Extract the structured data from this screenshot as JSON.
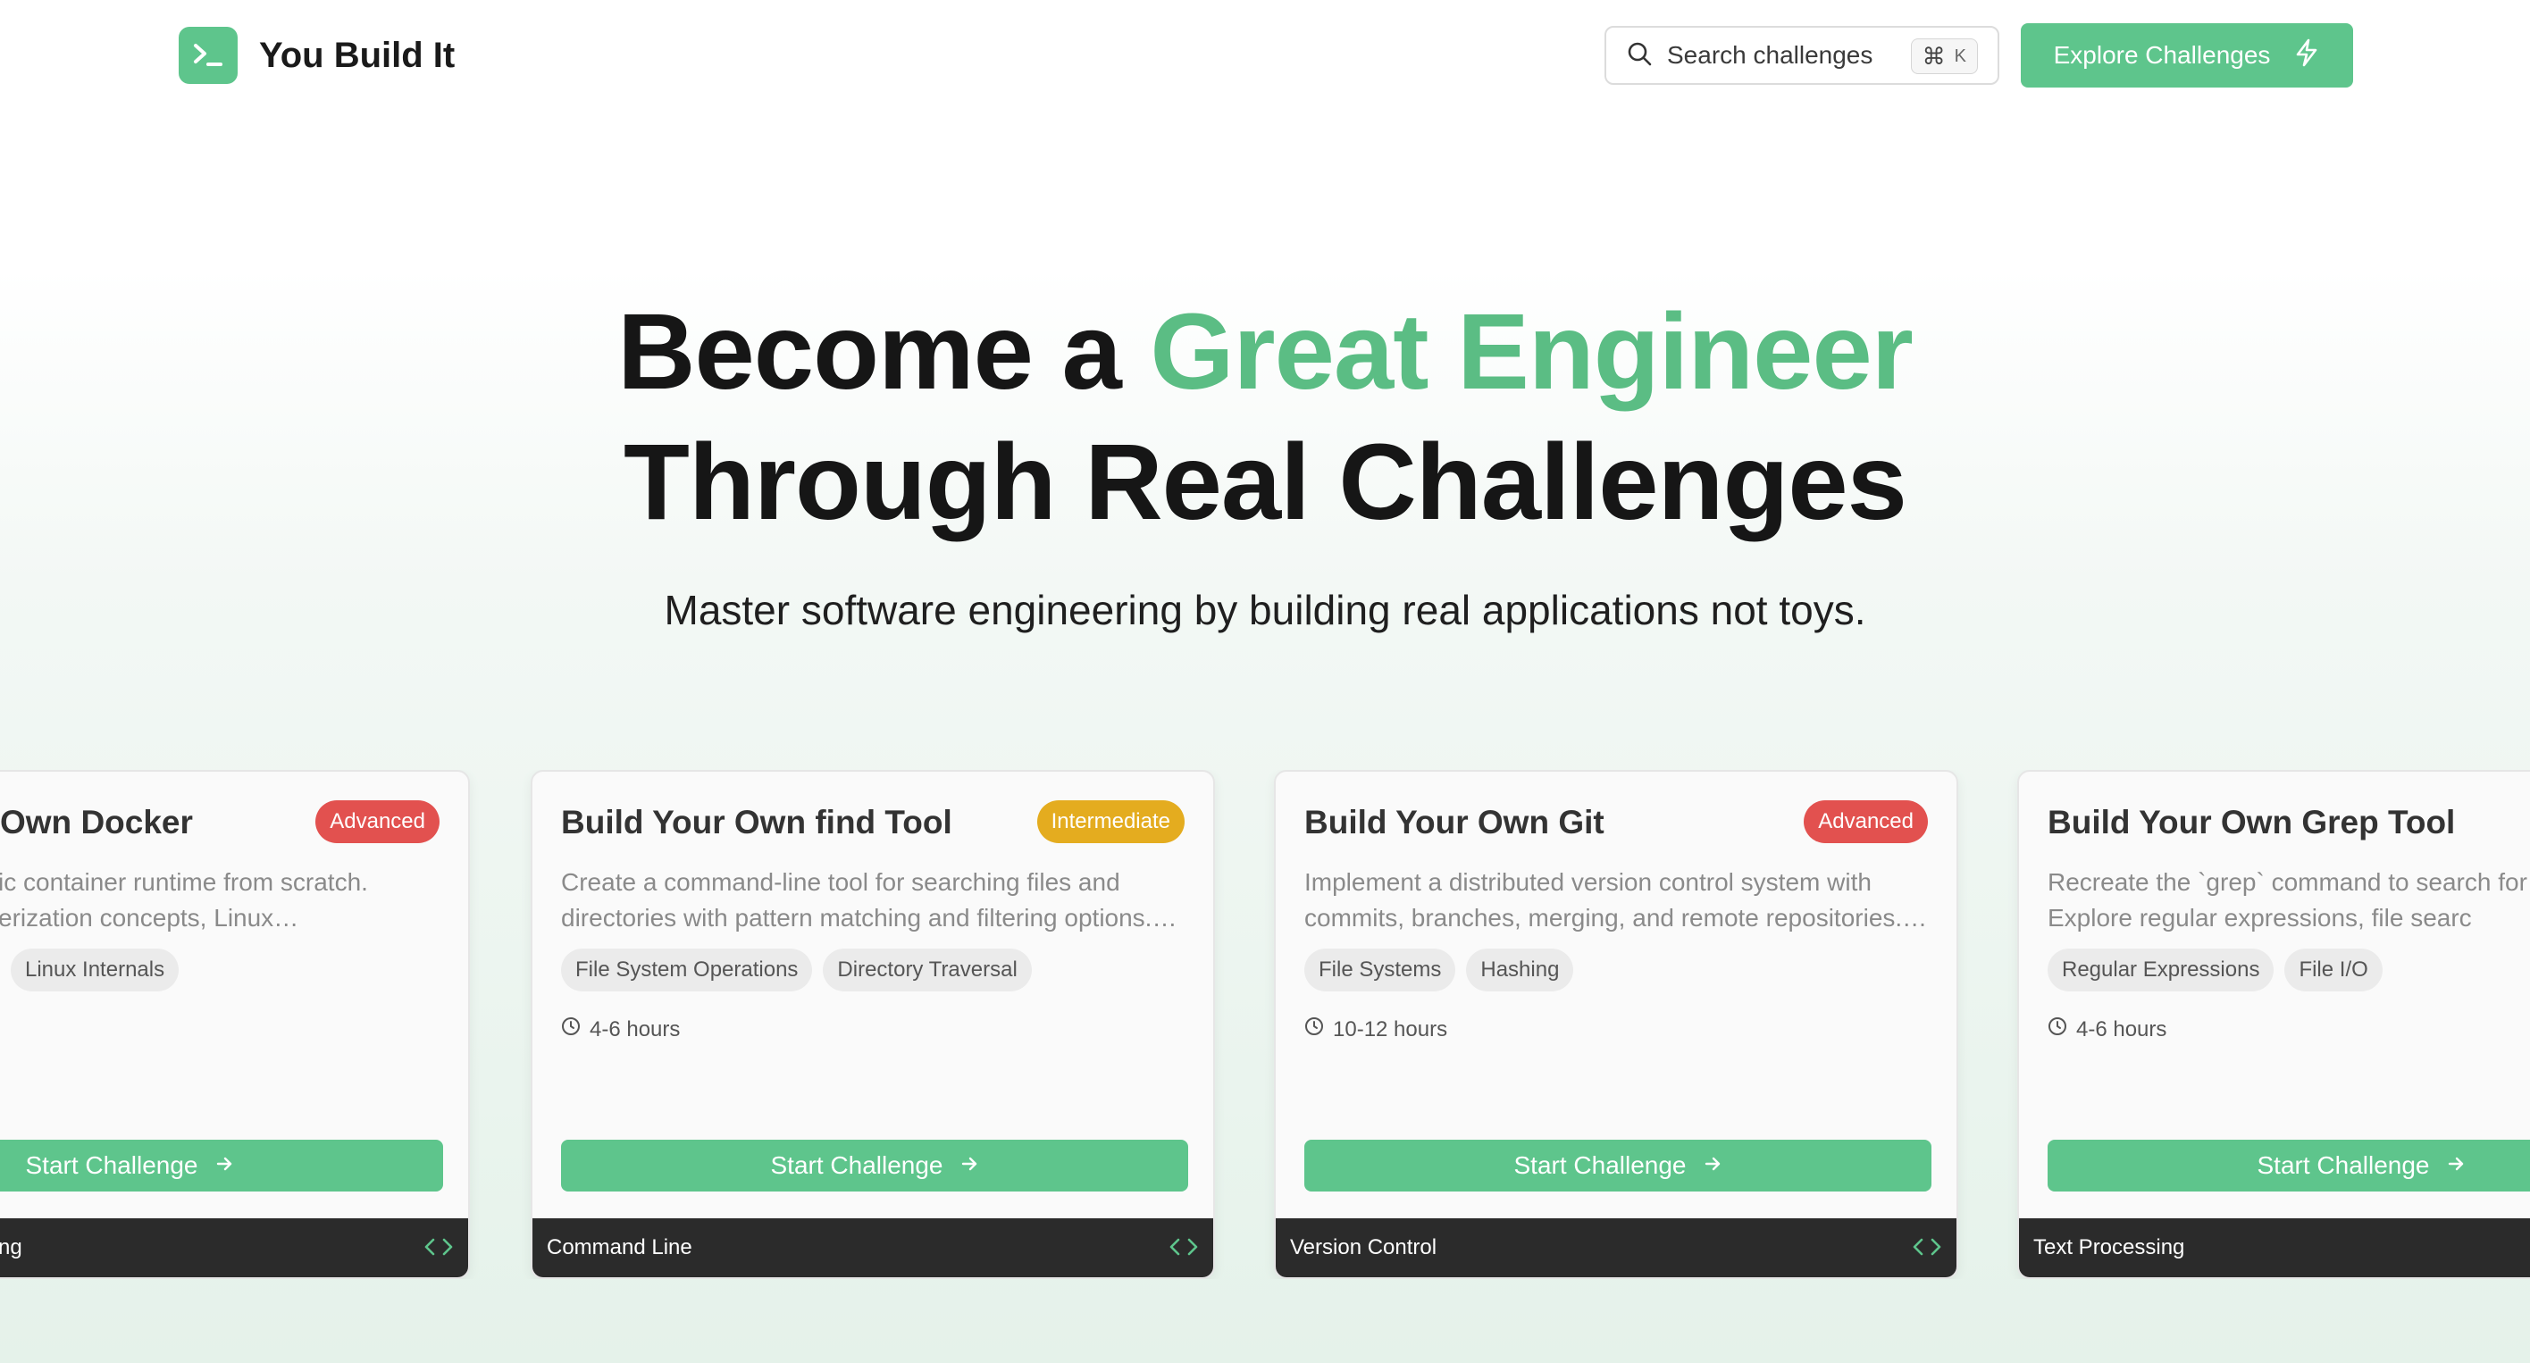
{
  "header": {
    "brand": "You Build It",
    "search_placeholder": "Search challenges",
    "shortcut_symbol": "⌘",
    "shortcut_key": "K",
    "explore_label": "Explore Challenges"
  },
  "hero": {
    "title_prefix": "Become a ",
    "title_accent": "Great Engineer",
    "title_line2": "Through Real Challenges",
    "subtitle": "Master software engineering by building real applications not toys."
  },
  "colors": {
    "accent": "#5ec58c",
    "advanced": "#e2514f",
    "intermediate": "#e4ac1f",
    "footer": "#2b2b2b"
  },
  "icons": [
    "terminal-icon",
    "search-icon",
    "bolt-icon",
    "clock-icon",
    "arrow-right-icon",
    "code-icon"
  ],
  "cards": [
    {
      "title": "Own Docker",
      "difficulty": "Advanced",
      "description": "ic container runtime from scratch. erization concepts, Linux namespaces…",
      "tags": [
        "Linux Internals"
      ],
      "duration": "",
      "button": "Start Challenge",
      "category": "ng"
    },
    {
      "title": "Build Your Own find Tool",
      "difficulty": "Intermediate",
      "description": "Create a command-line tool for searching files and directories with pattern matching and filtering options.…",
      "tags": [
        "File System Operations",
        "Directory Traversal"
      ],
      "duration": "4-6 hours",
      "button": "Start Challenge",
      "category": "Command Line"
    },
    {
      "title": "Build Your Own Git",
      "difficulty": "Advanced",
      "description": "Implement a distributed version control system with commits, branches, merging, and remote repositories.…",
      "tags": [
        "File Systems",
        "Hashing"
      ],
      "duration": "10-12 hours",
      "button": "Start Challenge",
      "category": "Version Control"
    },
    {
      "title": "Build Your Own Grep Tool",
      "difficulty": "",
      "description": "Recreate the `grep` command to search for files. Explore regular expressions, file searc",
      "tags": [
        "Regular Expressions",
        "File I/O"
      ],
      "duration": "4-6 hours",
      "button": "Start Challenge",
      "category": "Text Processing"
    }
  ]
}
